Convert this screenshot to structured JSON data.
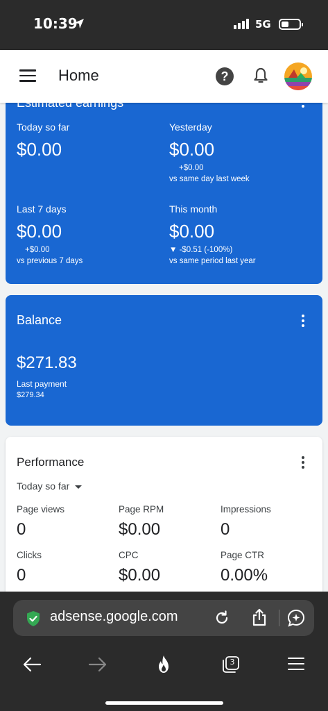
{
  "status_bar": {
    "time": "10:39",
    "network": "5G"
  },
  "header": {
    "title": "Home"
  },
  "estimated_earnings": {
    "title": "Estimated earnings",
    "today": {
      "label": "Today so far",
      "value": "$0.00"
    },
    "yesterday": {
      "label": "Yesterday",
      "value": "$0.00",
      "delta": "+$0.00",
      "comparison": "vs same day last week"
    },
    "last7": {
      "label": "Last 7 days",
      "value": "$0.00",
      "delta": "+$0.00",
      "comparison": "vs previous 7 days"
    },
    "month": {
      "label": "This month",
      "value": "$0.00",
      "delta": "▼ -$0.51 (-100%)",
      "comparison": "vs same period last year"
    }
  },
  "balance": {
    "title": "Balance",
    "amount": "$271.83",
    "last_payment_label": "Last payment",
    "last_payment_value": "$279.34"
  },
  "performance": {
    "title": "Performance",
    "range": "Today so far",
    "metrics": [
      {
        "label": "Page views",
        "value": "0"
      },
      {
        "label": "Page RPM",
        "value": "$0.00"
      },
      {
        "label": "Impressions",
        "value": "0"
      },
      {
        "label": "Clicks",
        "value": "0"
      },
      {
        "label": "CPC",
        "value": "$0.00"
      },
      {
        "label": "Page CTR",
        "value": "0.00%"
      }
    ]
  },
  "browser": {
    "url": "adsense.google.com",
    "tab_count": "3"
  },
  "colors": {
    "card_blue": "#1967d2",
    "chrome_dark": "#2b2b2b",
    "secure_green": "#34a853"
  },
  "icons": [
    "location-arrow-icon",
    "signal-icon",
    "battery-icon",
    "menu-icon",
    "help-icon",
    "bell-icon",
    "avatar",
    "shield-check-icon",
    "reload-icon",
    "share-icon",
    "ai-assistant-icon",
    "back-arrow-icon",
    "forward-arrow-icon",
    "flame-icon",
    "tabs-icon",
    "menu-lines-icon"
  ]
}
